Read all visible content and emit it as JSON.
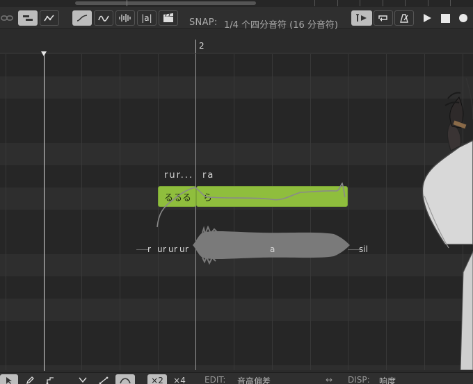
{
  "toolbar": {
    "snap_label": "SNAP:",
    "snap_value": "1/4 个四分音符 (16 分音符)",
    "alias_label": "|a|"
  },
  "ruler": {
    "measure": "2"
  },
  "notes": [
    {
      "lyric": "るるる",
      "phoneme": "rur..."
    },
    {
      "lyric": "ら",
      "phoneme": "ra"
    }
  ],
  "phonemes_bottom": [
    "r",
    "u",
    "r",
    "u",
    "r",
    "u",
    "r",
    "a",
    "sil"
  ],
  "bottom": {
    "x2": "×2",
    "x4": "×4",
    "edit_label": "EDIT:",
    "edit_value": "音高偏差",
    "arrows": "↔",
    "disp_label": "DISP:",
    "disp_value": "响度"
  },
  "icons": [
    "link-icon",
    "notes-tool-icon",
    "pitch-tool-icon",
    "curve-icon",
    "vibrato-icon",
    "waveform-icon",
    "alias-icon",
    "clapper-icon",
    "play-from-cursor-icon",
    "loop-icon",
    "metronome-icon",
    "play-icon",
    "stop-icon",
    "record-icon",
    "select-icon",
    "pen-icon",
    "pitch-pen-icon",
    "flatten-icon",
    "line-icon",
    "wave-curve-icon"
  ]
}
